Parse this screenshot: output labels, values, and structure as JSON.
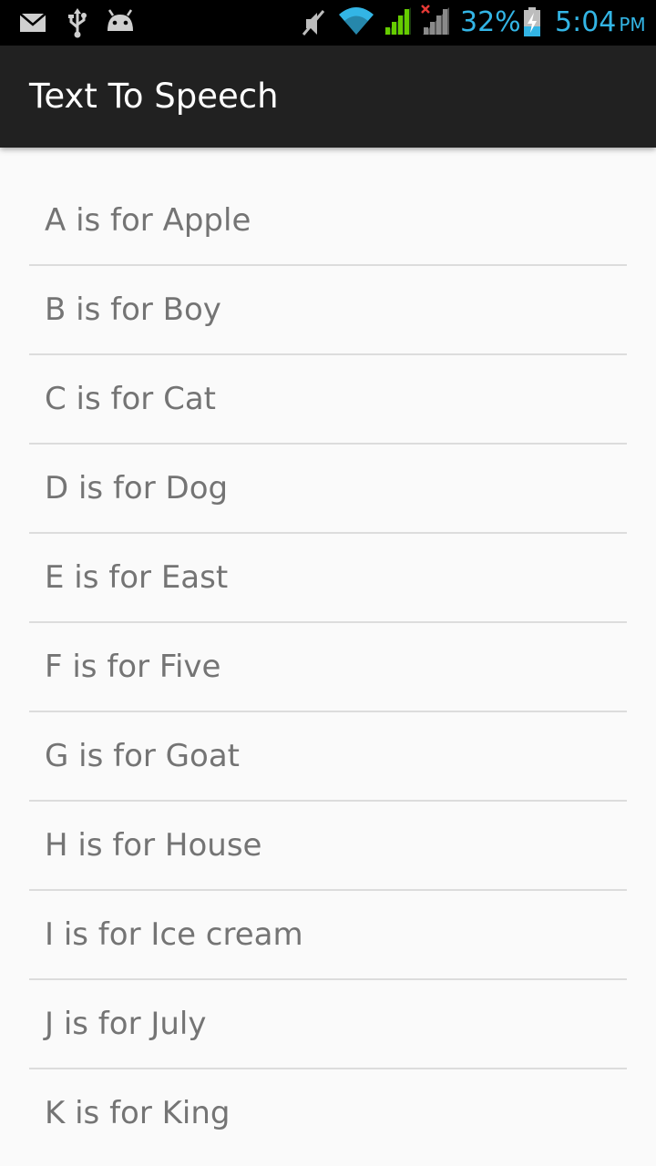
{
  "status_bar": {
    "battery_percent": "32%",
    "time": "5:04",
    "ampm": "PM",
    "icons_left": [
      "gmail-icon",
      "usb-icon",
      "android-debug-icon"
    ],
    "icons_right": [
      "mute-icon",
      "wifi-icon",
      "signal-icon",
      "signal-no-sim-icon",
      "battery-charging-icon"
    ],
    "accent_color": "#33b5e5"
  },
  "app": {
    "title": "Text To Speech",
    "action_bar_color": "#212121"
  },
  "list": {
    "items": [
      "A is for Apple",
      "B is for Boy",
      "C is for Cat",
      "D is for Dog",
      "E is for East",
      "F is for Five",
      "G is for Goat",
      "H is for House",
      "I is for Ice cream",
      "J is for July",
      "K is for King"
    ],
    "text_color": "#747474"
  }
}
